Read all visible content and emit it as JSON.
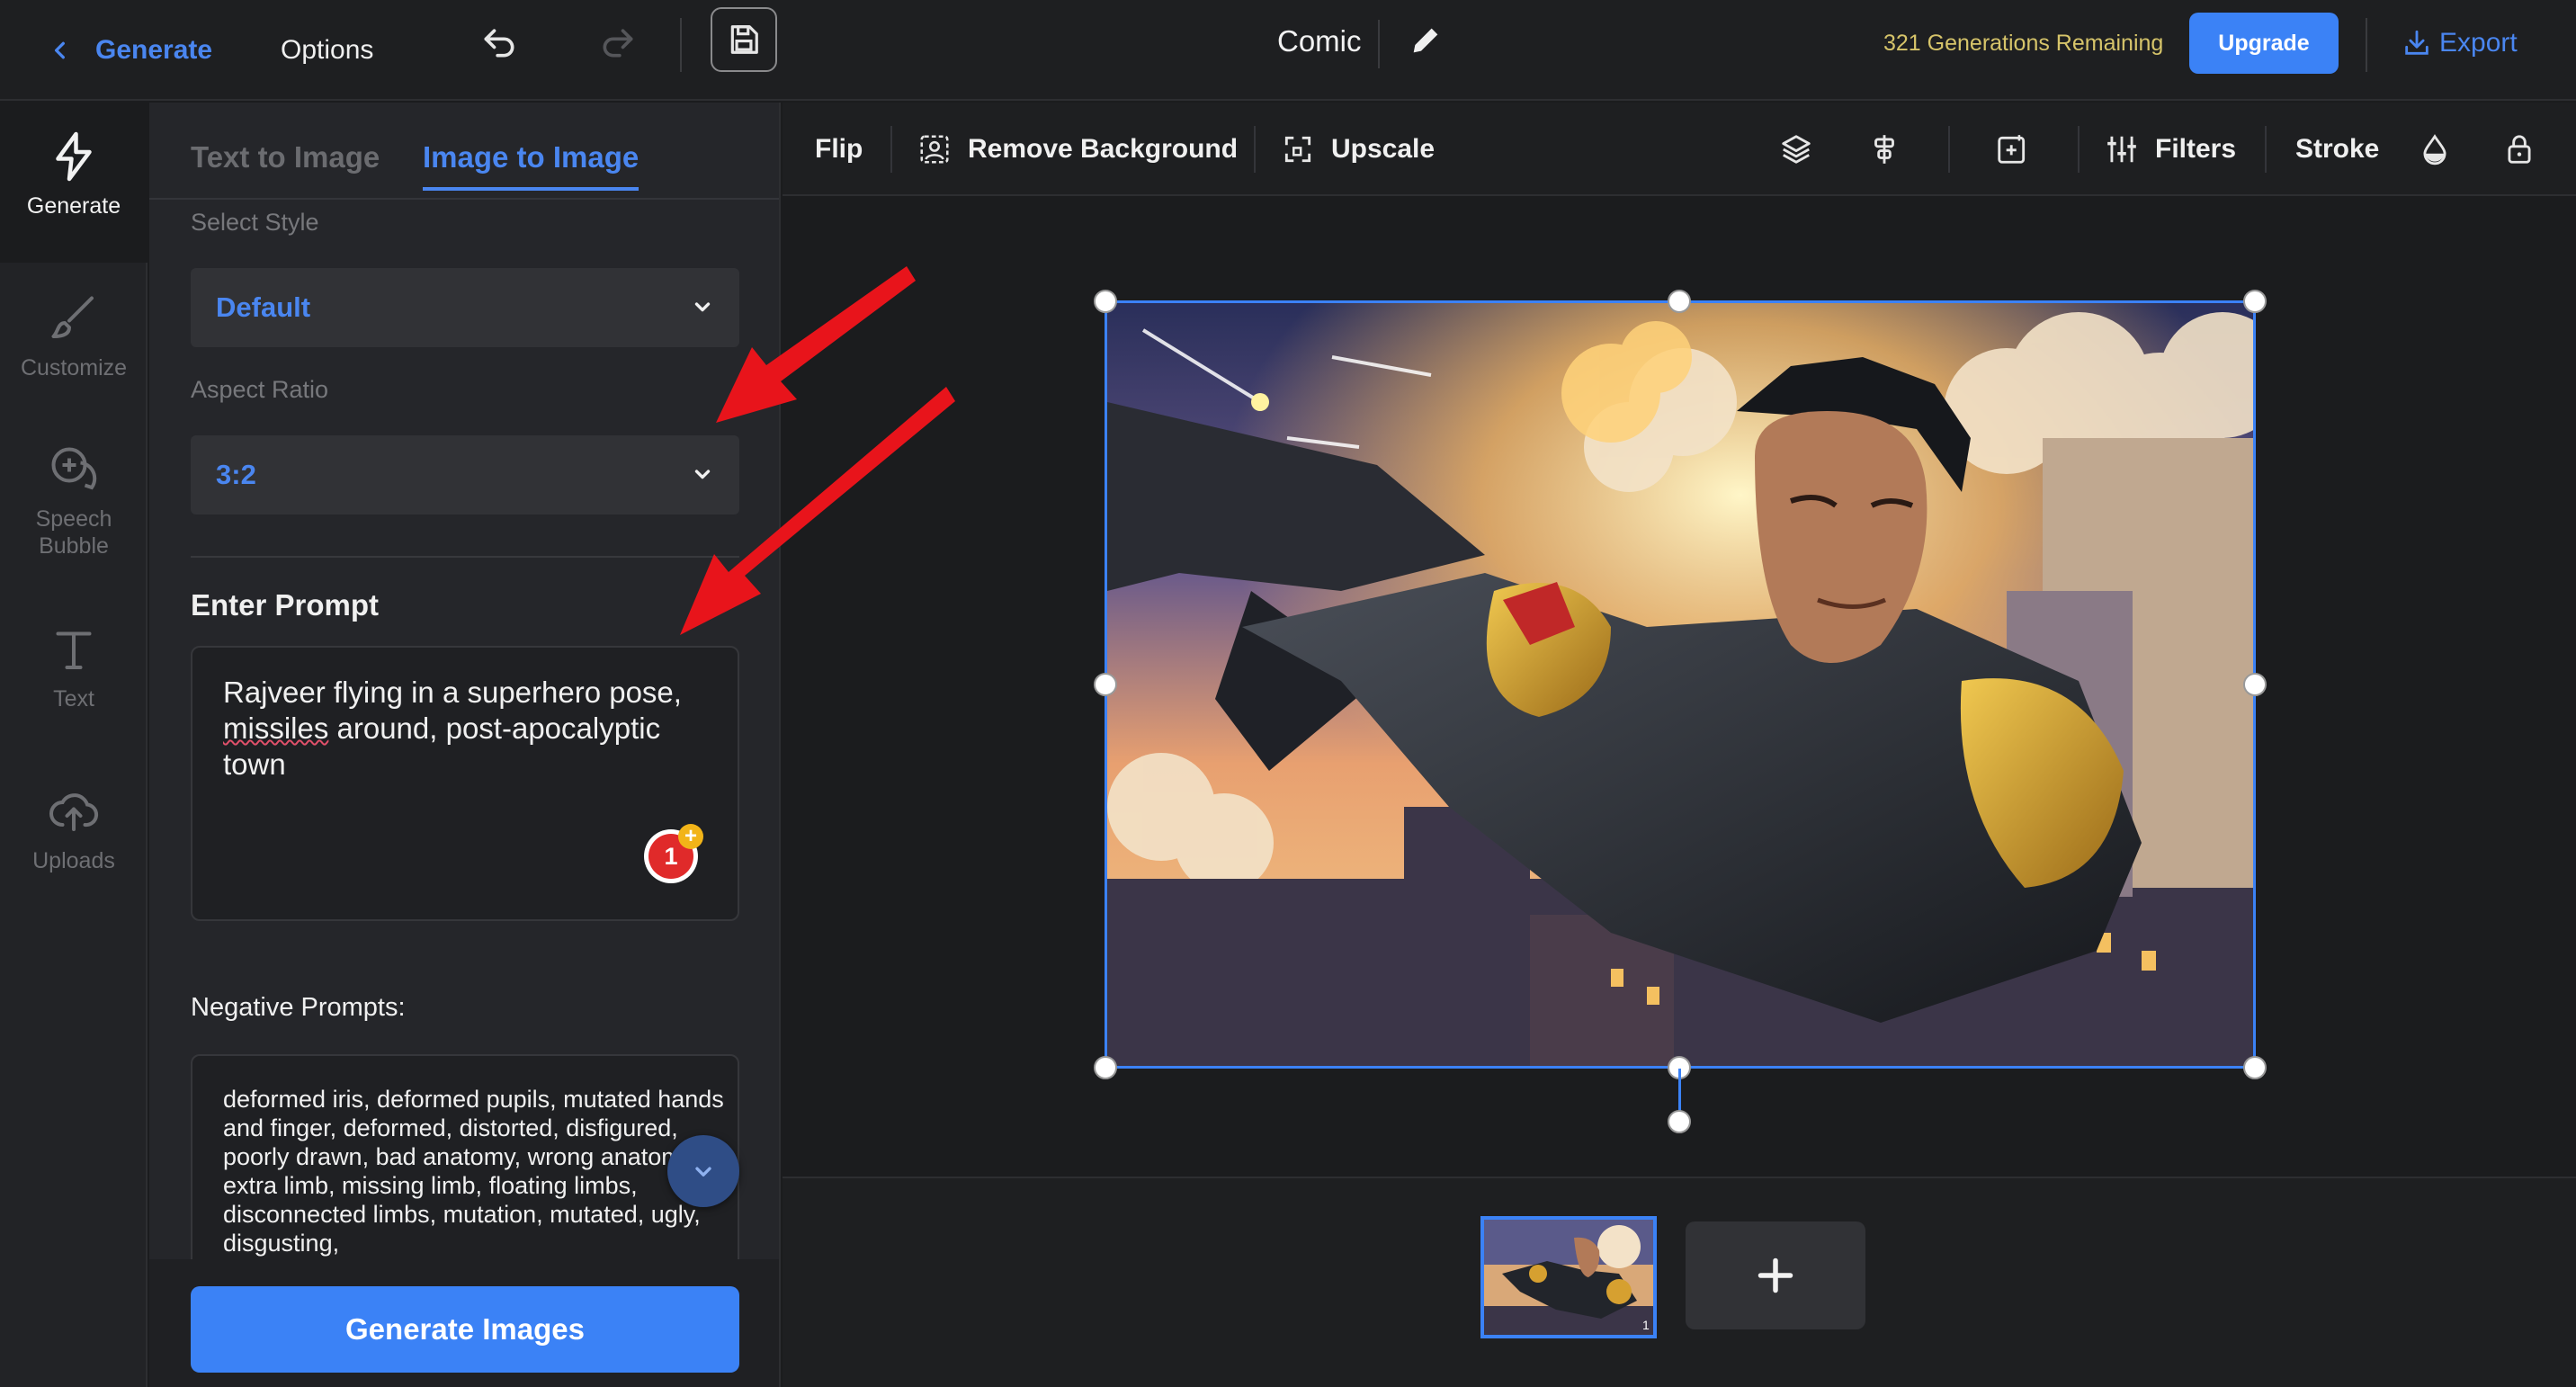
{
  "topbar": {
    "back_label": "Generate",
    "options_label": "Options",
    "project_name": "Comic",
    "generations_remaining": "321 Generations Remaining",
    "upgrade_label": "Upgrade",
    "export_label": "Export"
  },
  "rail": {
    "items": [
      {
        "label": "Generate",
        "icon": "lightning-icon",
        "active": true
      },
      {
        "label": "Customize",
        "icon": "brush-icon"
      },
      {
        "label": "Speech\nBubble",
        "icon": "speech-bubble-icon"
      },
      {
        "label": "Text",
        "icon": "text-icon"
      },
      {
        "label": "Uploads",
        "icon": "cloud-upload-icon"
      }
    ]
  },
  "panel": {
    "tabs": [
      "Text to Image",
      "Image to Image"
    ],
    "active_tab": "Image to Image",
    "style_label": "Select Style",
    "style_value": "Default",
    "ratio_label": "Aspect Ratio",
    "ratio_value": "3:2",
    "prompt_label": "Enter Prompt",
    "prompt_part1": "Rajveer flying in a superhero pose, ",
    "prompt_misspelled": "missiles",
    "prompt_part2": " around, post-apocalyptic town",
    "badge_count": "1",
    "badge_plus": "+",
    "negative_label": "Negative Prompts:",
    "negative_value": "deformed iris, deformed pupils, mutated hands and finger, deformed, distorted, disfigured, poorly drawn, bad anatomy, wrong anatomy, extra limb, missing limb, floating limbs, disconnected limbs, mutation, mutated, ugly, disgusting,",
    "generate_label": "Generate Images"
  },
  "toolbar": {
    "flip": "Flip",
    "remove_bg": "Remove Background",
    "upscale": "Upscale",
    "filters": "Filters",
    "stroke": "Stroke"
  },
  "strip": {
    "thumb_page": "1",
    "add_label": "+"
  },
  "colors": {
    "accent": "#3b82f6",
    "link": "#4a86f0",
    "generations_text": "#d6c46a",
    "annotation_arrow": "#e8141b"
  }
}
